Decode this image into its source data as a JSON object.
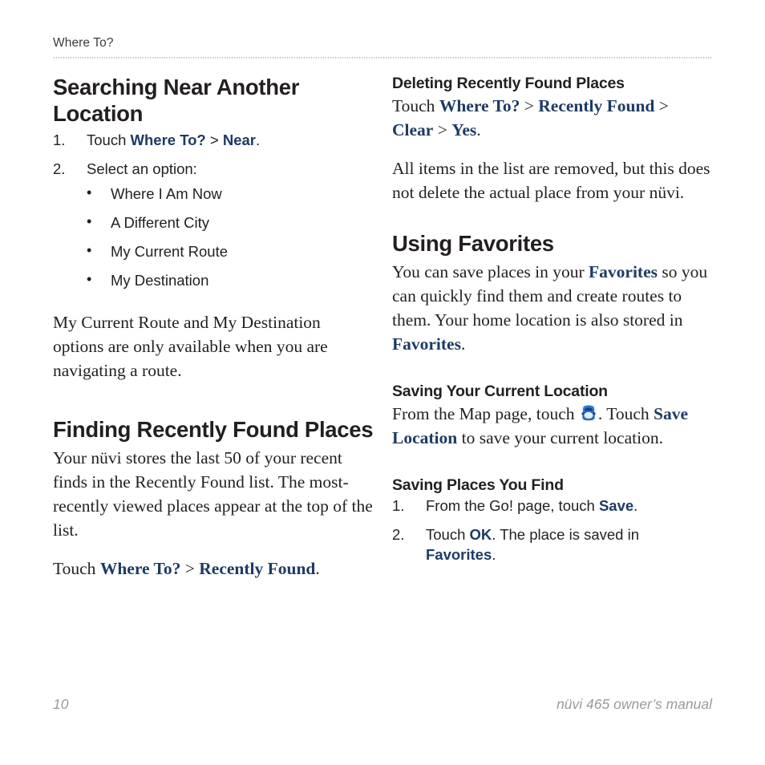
{
  "page": {
    "running_header": "Where To?",
    "footer": {
      "page_number": "10",
      "manual_title": "nüvi 465 owner’s manual"
    },
    "accent_color": "#1d3b64",
    "text_color": "#231f20",
    "footer_color": "#9a9a9a",
    "rule_color": "#b4b4b4"
  },
  "left_column": {
    "section1": {
      "heading": "Searching Near Another Location",
      "steps": [
        {
          "num": "1.",
          "lead": "Touch ",
          "ui1": "Where To?",
          "sep1": " > ",
          "ui2": "Near",
          "tail": "."
        },
        {
          "num": "2.",
          "lead": "Select an option:",
          "bullets": [
            {
              "marker": "•",
              "label": "Where I Am Now"
            },
            {
              "marker": "•",
              "label": "A Different City"
            },
            {
              "marker": "•",
              "label": "My Current Route"
            },
            {
              "marker": "•",
              "label": "My Destination"
            }
          ]
        }
      ],
      "paragraph": "My Current Route and My Destination options are only available when you are navigating a route."
    },
    "section2": {
      "heading": "Finding Recently Found Places",
      "paragraph": "Your nüvi stores the last 50 of your recent finds in the Recently Found list. The most-recently viewed places appear at the top of the list.",
      "touch_line": {
        "lead": "Touch ",
        "ui1": "Where To?",
        "sep1": " > ",
        "ui2": "Recently Found",
        "tail": "."
      }
    }
  },
  "right_column": {
    "sub1": {
      "heading": "Deleting Recently Found Places",
      "touch_line": {
        "lead": "Touch ",
        "ui1": "Where To?",
        "sep1": " > ",
        "ui2": "Recently Found",
        "sep2": " > ",
        "ui3": "Clear",
        "sep3": " > ",
        "ui4": "Yes",
        "tail": "."
      },
      "paragraph": "All items in the list are removed, but this does not delete the actual place from your nüvi."
    },
    "section1": {
      "heading": "Using Favorites",
      "paragraph": {
        "part1": "You can save places in your ",
        "ui1": "Favorites",
        "part2": " so you can quickly find them and create routes to them. Your home location is also stored in ",
        "ui2": "Favorites",
        "part3": "."
      }
    },
    "sub2": {
      "heading": "Saving Your Current Location",
      "paragraph": {
        "part1": "From the Map page, touch ",
        "icon": "vehicle-icon",
        "part2": ". Touch ",
        "ui1": "Save Location",
        "part3": " to save your current location."
      }
    },
    "sub3": {
      "heading": "Saving Places You Find",
      "steps": [
        {
          "num": "1.",
          "lead": "From the Go! page, touch ",
          "ui1": "Save",
          "tail": "."
        },
        {
          "num": "2.",
          "lead": "Touch ",
          "ui1": "OK",
          "mid": ". The place is saved in ",
          "ui2": "Favorites",
          "tail": "."
        }
      ]
    }
  }
}
